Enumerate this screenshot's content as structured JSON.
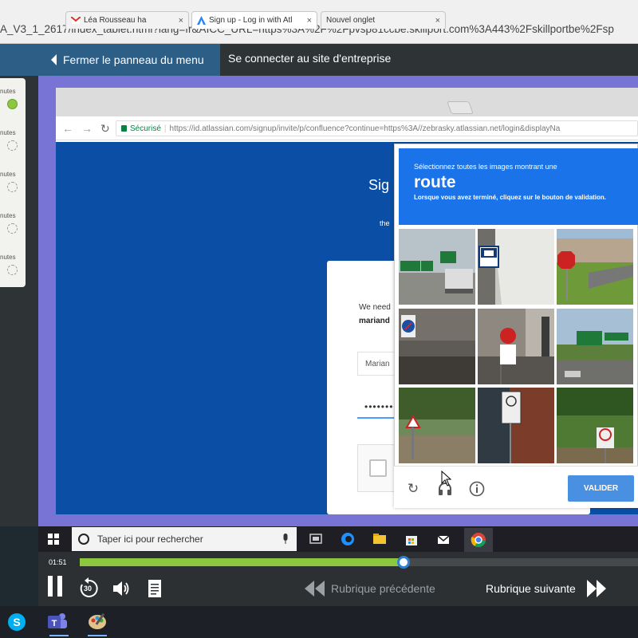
{
  "top_url": "A_V3_1_2617/index_tablet.html?lang=fr&AICC_URL=https%3A%2F%2Fpvsp81ccbe.skillport.com%3A443%2Fskillportbe%2Fsp",
  "player": {
    "close_panel_label": "Fermer le panneau du menu",
    "connect_label": "Se connecter au site d'entreprise",
    "time": "01:51",
    "progress_fraction": 0.58,
    "prev_label": "Rubrique précédente",
    "next_label": "Rubrique suivante",
    "replay_label": "30"
  },
  "sidebar": {
    "items": [
      {
        "label": "nutes",
        "done": true
      },
      {
        "label": "nutes",
        "done": false
      },
      {
        "label": "nutes",
        "done": false
      },
      {
        "label": "nutes",
        "done": false
      },
      {
        "label": "nutes",
        "done": false
      }
    ]
  },
  "browser": {
    "tabs": [
      {
        "title": "L&eacute;a Rousseau ha",
        "icon": "gmail-icon"
      },
      {
        "title": "Sign up - Log in with Atl",
        "icon": "atlassian-icon"
      },
      {
        "title": "Nouvel onglet",
        "icon": ""
      }
    ],
    "secure_label": "Sécurisé",
    "address": "https://id.atlassian.com/signup/invite/p/confluence?continue=https%3A//zebrasky.atlassian.net/login&displayNa"
  },
  "page": {
    "title": "Sig",
    "subtitle": "the",
    "we_need": "We need",
    "email": "mariand",
    "name_value": "Marian",
    "password_value": "••••••••"
  },
  "captcha": {
    "instruction": "Sélectionnez toutes les images montrant une",
    "keyword": "route",
    "hint": "Lorsque vous avez terminé, cliquez sur le bouton de validation.",
    "verify_label": "VALIDER"
  },
  "windows_taskbar": {
    "search_placeholder": "Taper ici pour rechercher"
  },
  "colors": {
    "player_blue": "#2d5e86",
    "progress_green": "#8dc63f",
    "captcha_blue": "#1a73e8",
    "verify_blue": "#4a90e2",
    "atlassian_blue": "#0a4ea5",
    "backdrop_purple": "#7874d6"
  }
}
